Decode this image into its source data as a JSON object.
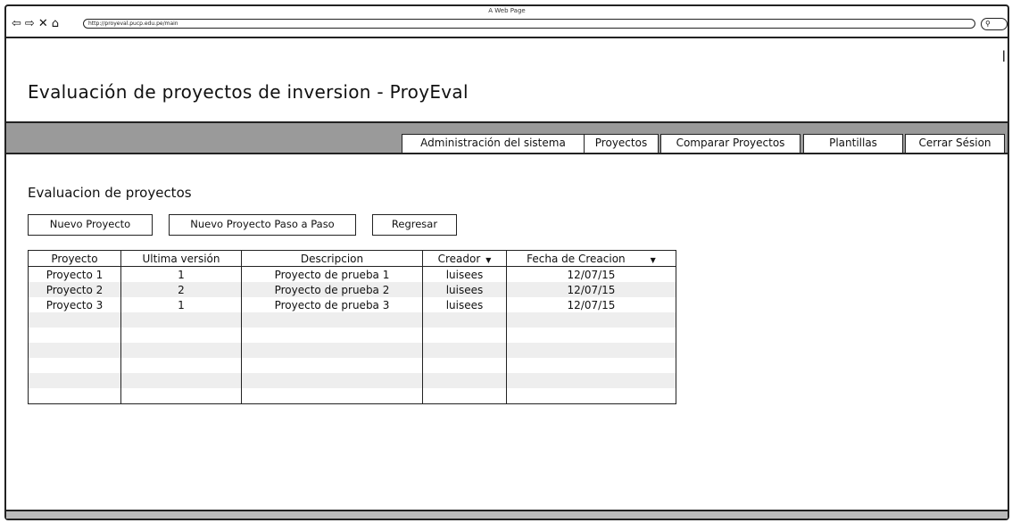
{
  "window": {
    "title": "A Web Page",
    "url": "http://proyeval.pucp.edu.pe/main"
  },
  "app": {
    "title": "Evaluación de proyectos de inversion - ProyEval"
  },
  "nav": [
    "Administración del sistema",
    "Proyectos",
    "Comparar Proyectos",
    "Plantillas",
    "Cerrar Sésion"
  ],
  "section": {
    "title": "Evaluacion de proyectos"
  },
  "actions": {
    "new_project": "Nuevo Proyecto",
    "new_project_step": "Nuevo Proyecto Paso a Paso",
    "back": "Regresar"
  },
  "table": {
    "columns": [
      "Proyecto",
      "Ultima versión",
      "Descripcion",
      "Creador",
      "Fecha de Creacion"
    ],
    "rows": [
      [
        "Proyecto 1",
        "1",
        "Proyecto de prueba 1",
        "luisees",
        "12/07/15"
      ],
      [
        "Proyecto 2",
        "2",
        "Proyecto de prueba 2",
        "luisees",
        "12/07/15"
      ],
      [
        "Proyecto 3",
        "1",
        "Proyecto de prueba 3",
        "luisees",
        "12/07/15"
      ]
    ],
    "empty_rows": 6
  },
  "icons": {
    "back": "left-arrow-icon",
    "forward": "right-arrow-icon",
    "stop": "close-icon",
    "home": "home-icon",
    "search": "search-icon",
    "sort": "sort-down-icon"
  }
}
